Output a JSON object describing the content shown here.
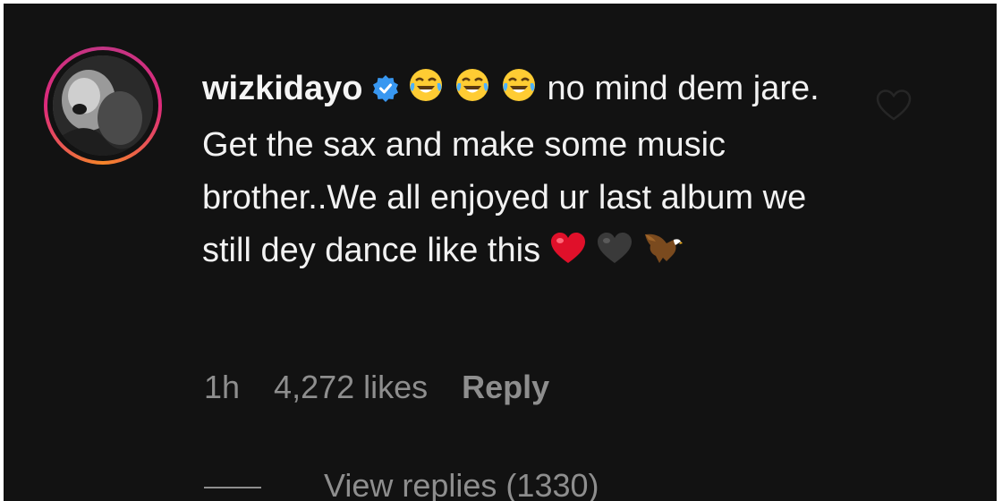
{
  "comment": {
    "username": "wizkidayo",
    "verified": true,
    "text_line1": "no mind",
    "text_rest": "dem jare. Get the sax and make some music brother..We all enjoyed ur last album we still dey dance like this",
    "leading_emojis": [
      "face-with-tears-of-joy-icon",
      "face-with-tears-of-joy-icon",
      "face-with-tears-of-joy-icon"
    ],
    "trailing_emojis": [
      "red-heart-icon",
      "black-heart-icon",
      "eagle-icon"
    ]
  },
  "meta": {
    "time": "1h",
    "likes": "4,272 likes",
    "reply": "Reply"
  },
  "replies": {
    "label": "View replies (1330)"
  },
  "colors": {
    "background": "#121212",
    "text": "#f2f2f2",
    "muted": "#8e8e8e",
    "verified": "#3897f0"
  }
}
